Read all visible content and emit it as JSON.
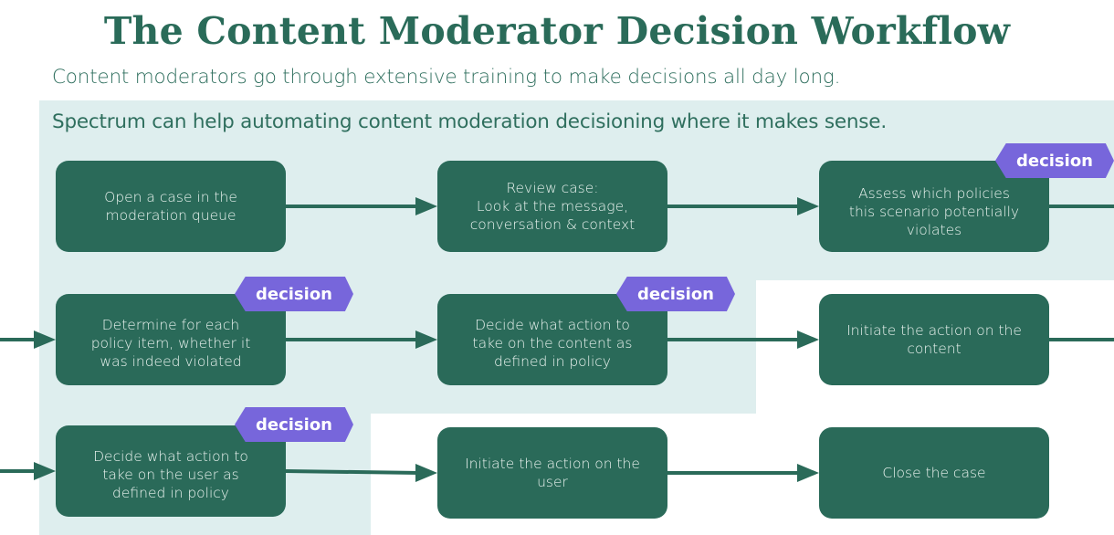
{
  "header": {
    "title": "The Content Moderator Decision Workflow",
    "subtitle": "Content moderators go through extensive training to make decisions all day long.",
    "spectrum_note": "Spectrum can help automating content moderation decisioning where it makes sense."
  },
  "colors": {
    "title": "#2a6b59",
    "box_fill": "#2a6a59",
    "box_text": "#eaf3ef",
    "highlight_band": "#deeeee",
    "badge_fill": "#7766db",
    "badge_text": "#ffffff",
    "connector": "#2a6a59"
  },
  "steps": [
    {
      "id": 1,
      "label": "Open a case in the moderation queue",
      "decision": false,
      "automatable": true
    },
    {
      "id": 2,
      "label": "Review case: Look at the message, conversation & context",
      "decision": false,
      "automatable": true
    },
    {
      "id": 3,
      "label": "Assess which policies this scenario potentially violates",
      "decision": true,
      "automatable": true
    },
    {
      "id": 4,
      "label": "Determine for each policy item, whether it was indeed violated",
      "decision": true,
      "automatable": true
    },
    {
      "id": 5,
      "label": "Decide what action to take on the content as defined in policy",
      "decision": true,
      "automatable": true
    },
    {
      "id": 6,
      "label": "Initiate the action on the content",
      "decision": false,
      "automatable": false
    },
    {
      "id": 7,
      "label": "Decide what action to take on the user as defined in policy",
      "decision": true,
      "automatable": true
    },
    {
      "id": 8,
      "label": "Initiate the action on the user",
      "decision": false,
      "automatable": false
    },
    {
      "id": 9,
      "label": "Close the case",
      "decision": false,
      "automatable": false
    }
  ],
  "step_lines": {
    "s1": "Open a case in the\nmoderation queue",
    "s2": "Review case:\nLook at the message,\nconversation & context",
    "s3": "Assess which policies\nthis scenario potentially\nviolates",
    "s4": "Determine for each\npolicy item, whether it\nwas indeed violated",
    "s5": "Decide what action to\ntake on the content as\ndefined in policy",
    "s6": "Initiate the action on the\ncontent",
    "s7": "Decide what action to\ntake on the user as\ndefined in policy",
    "s8": "Initiate the action on the\nuser",
    "s9": "Close the case"
  },
  "badge_label": "decision",
  "edges": [
    [
      1,
      2
    ],
    [
      2,
      3
    ],
    [
      3,
      4
    ],
    [
      4,
      5
    ],
    [
      5,
      6
    ],
    [
      6,
      7
    ],
    [
      7,
      8
    ],
    [
      8,
      9
    ]
  ]
}
